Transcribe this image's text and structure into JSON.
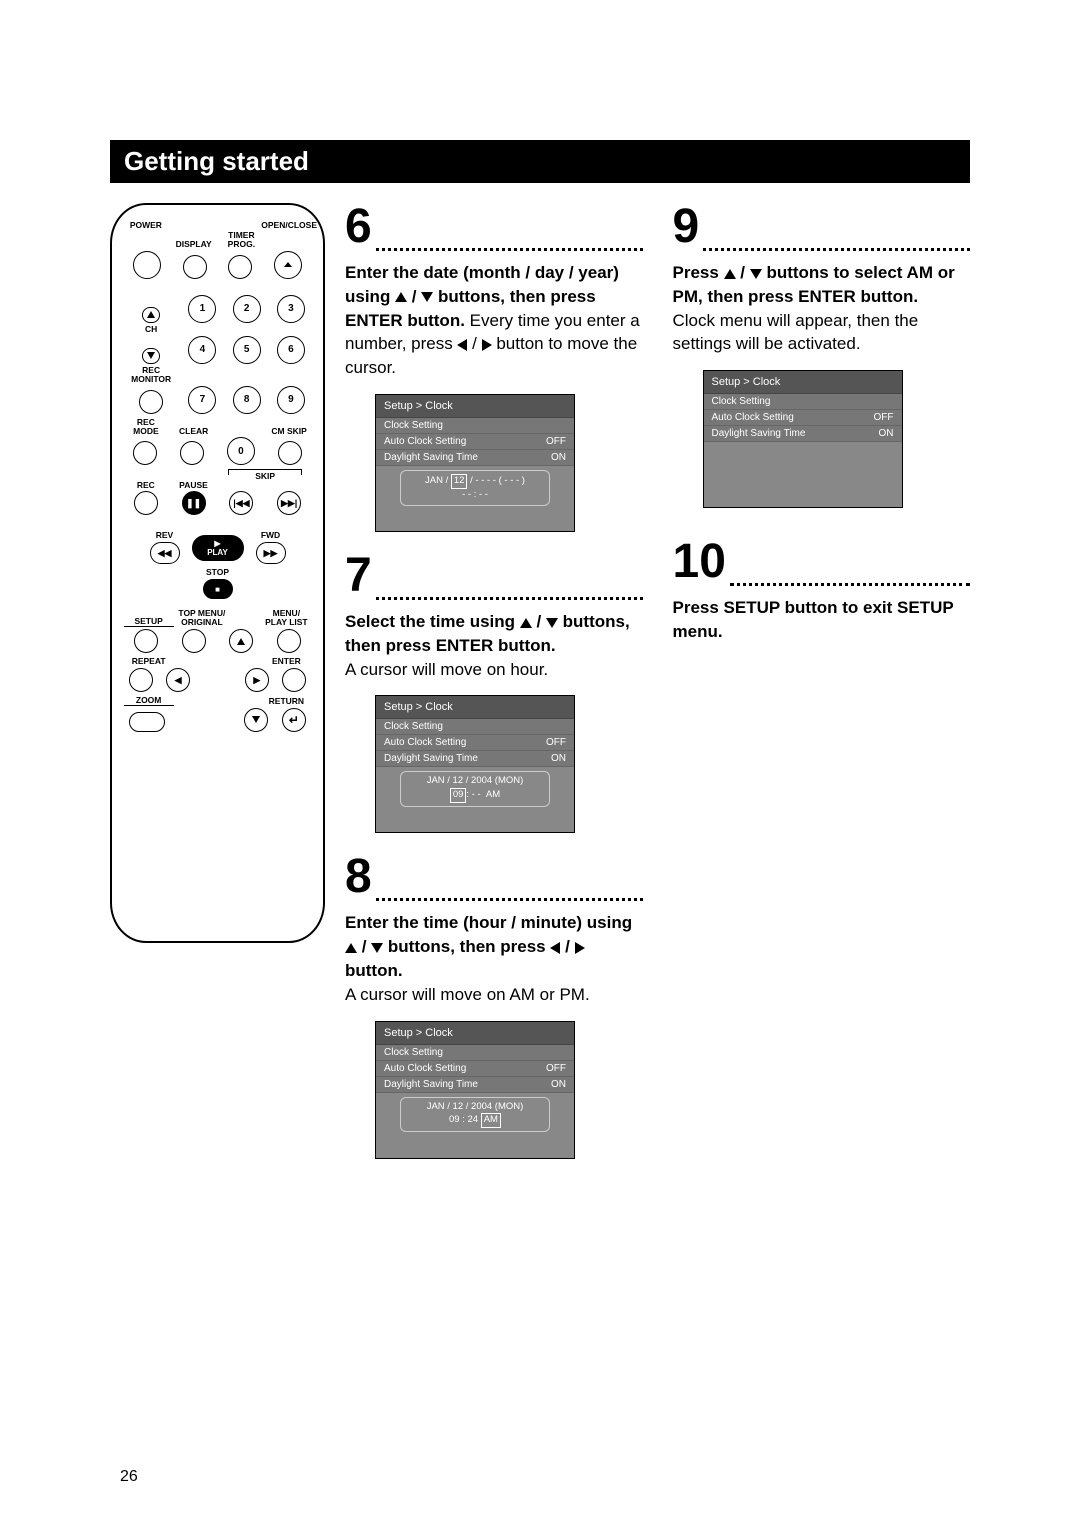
{
  "header": "Getting started",
  "page_number": "26",
  "remote": {
    "power": "POWER",
    "display": "DISPLAY",
    "timer_prog": "TIMER\nPROG.",
    "open_close": "OPEN/CLOSE",
    "ch": "CH",
    "rec_monitor": "REC\nMONITOR",
    "rec_mode": "REC MODE",
    "clear": "CLEAR",
    "cm_skip": "CM SKIP",
    "rec": "REC",
    "pause": "PAUSE",
    "skip": "SKIP",
    "play": "PLAY",
    "rev": "REV",
    "fwd": "FWD",
    "stop": "STOP",
    "setup": "SETUP",
    "top_menu": "TOP MENU/\nORIGINAL",
    "menu_playlist": "MENU/\nPLAY LIST",
    "repeat": "REPEAT",
    "enter": "ENTER",
    "zoom": "ZOOM",
    "return": "RETURN",
    "digits": [
      "1",
      "2",
      "3",
      "4",
      "5",
      "6",
      "7",
      "8",
      "9",
      "0"
    ]
  },
  "steps": {
    "s6": {
      "num": "6",
      "bold": "Enter the date (month / day / year) using ▲ / ▼ buttons, then press ENTER button.",
      "plain": "Every time you enter a number, press ◀ / ▶ button to move the cursor.",
      "osd": {
        "title": "Setup > Clock",
        "r1": "Clock Setting",
        "r2l": "Auto Clock Setting",
        "r2r": "OFF",
        "r3l": "Daylight Saving Time",
        "r3r": "ON",
        "panel1": "JAN / 12 / - - - - ( - - - )",
        "panel2": "- - : - -",
        "boxval": "12"
      }
    },
    "s7": {
      "num": "7",
      "bold": "Select the time using ▲ / ▼ buttons, then press ENTER button.",
      "plain": "A cursor will move on hour.",
      "osd": {
        "title": "Setup > Clock",
        "r1": "Clock Setting",
        "r2l": "Auto Clock Setting",
        "r2r": "OFF",
        "r3l": "Daylight Saving Time",
        "r3r": "ON",
        "panel1": "JAN / 12 / 2004 (MON)",
        "panel2": "09: - -  AM",
        "boxval": "09"
      }
    },
    "s8": {
      "num": "8",
      "bold": "Enter the time (hour / minute) using ▲ / ▼ buttons, then press ◀ / ▶ button.",
      "plain": "A cursor will move on AM or PM.",
      "osd": {
        "title": "Setup > Clock",
        "r1": "Clock Setting",
        "r2l": "Auto Clock Setting",
        "r2r": "OFF",
        "r3l": "Daylight Saving Time",
        "r3r": "ON",
        "panel1": "JAN / 12 / 2004 (MON)",
        "panel2": "09 : 24 AM",
        "boxval": "AM"
      }
    },
    "s9": {
      "num": "9",
      "bold": "Press ▲ / ▼ buttons to select AM or PM, then press ENTER button.",
      "plain": "Clock menu will appear, then the settings will be activated.",
      "osd": {
        "title": "Setup > Clock",
        "r1": "Clock Setting",
        "r2l": "Auto Clock Setting",
        "r2r": "OFF",
        "r3l": "Daylight Saving Time",
        "r3r": "ON"
      }
    },
    "s10": {
      "num": "10",
      "bold": "Press SETUP button to exit SETUP menu."
    }
  }
}
